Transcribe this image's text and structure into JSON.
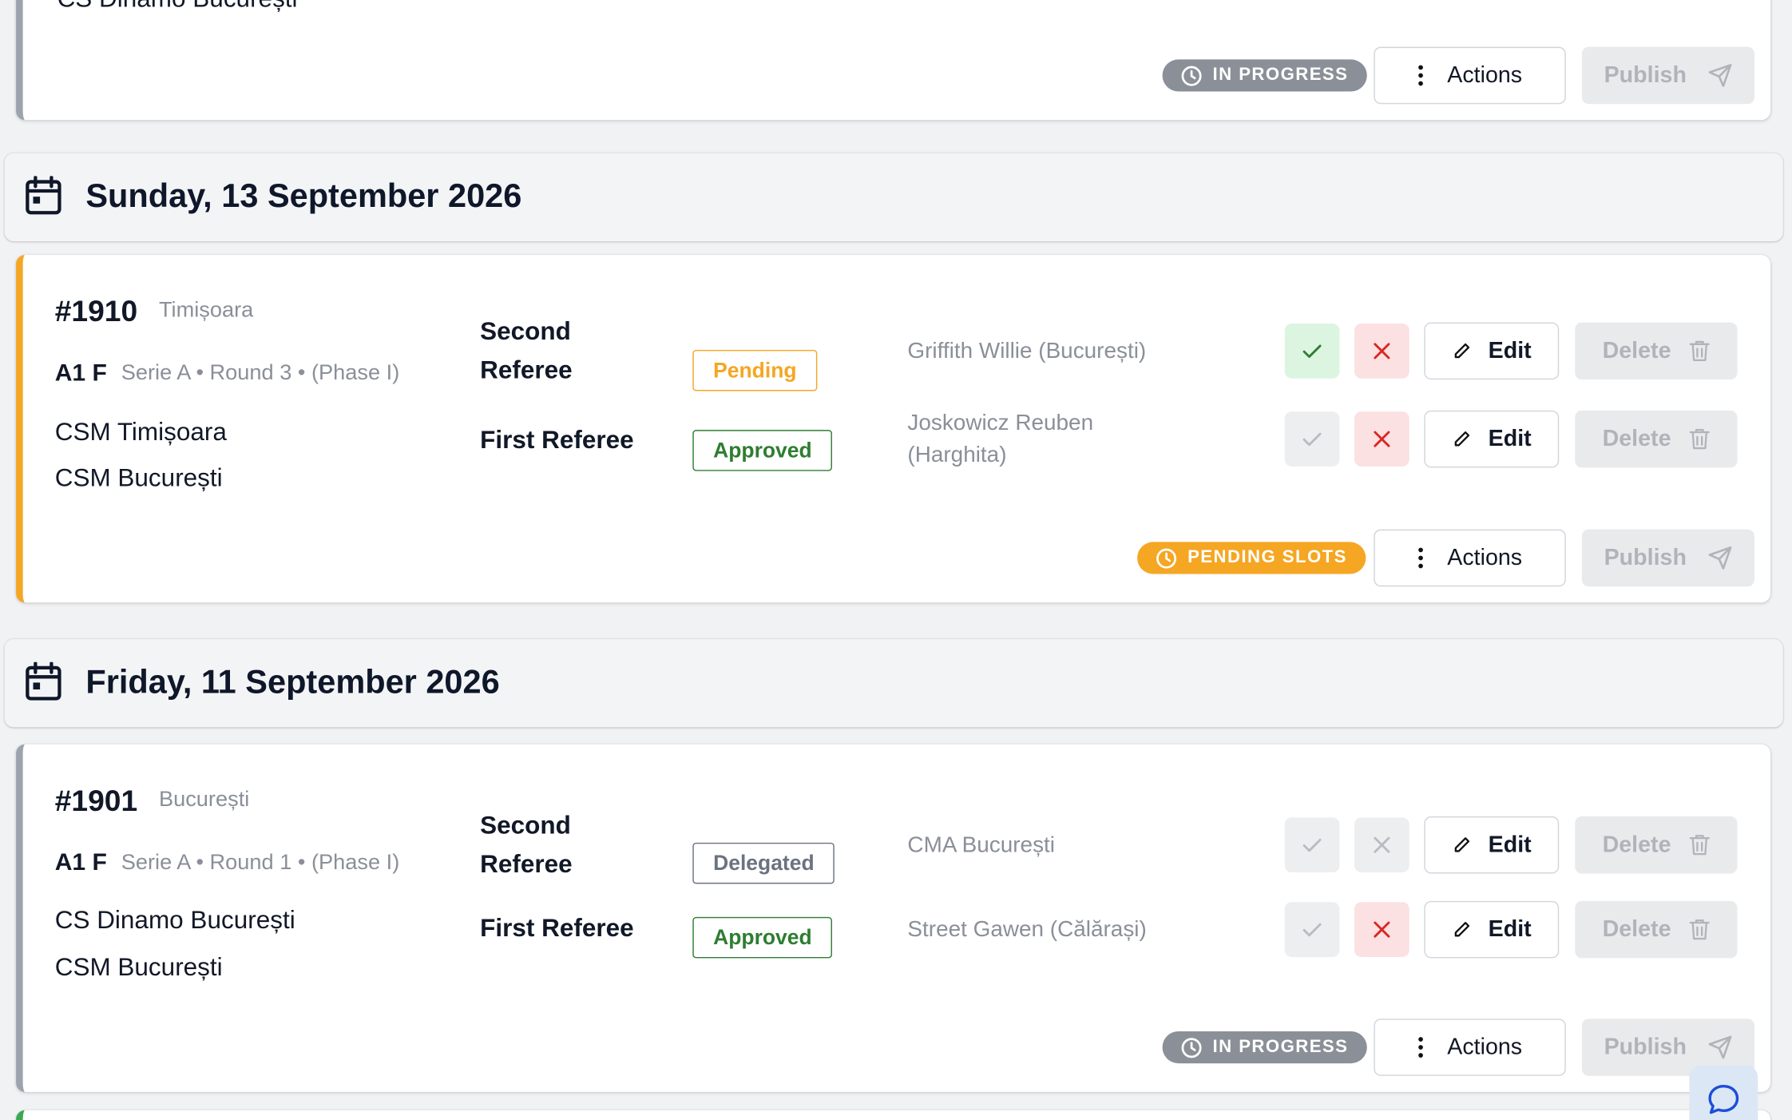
{
  "top_card": {
    "partial_team": "CS Dinamo București",
    "status": "IN PROGRESS",
    "actions_label": "Actions",
    "publish_label": "Publish"
  },
  "day1": {
    "title": "Sunday, 13 September 2026"
  },
  "match1910": {
    "number": "#1910",
    "city": "Timișoara",
    "category": "A1 F",
    "series": "Serie A • Round 3 • (Phase I)",
    "home": "CSM Timișoara",
    "away": "CSM București",
    "slots": [
      {
        "role_line1": "Second",
        "role_line2": "Referee",
        "status": "Pending",
        "person": "Griffith Willie (București)"
      },
      {
        "role": "First Referee",
        "status": "Approved",
        "person_line1": "Joskowicz Reuben",
        "person_line2": "(Harghita)"
      }
    ],
    "status_badge": "PENDING SLOTS",
    "actions_label": "Actions",
    "publish_label": "Publish"
  },
  "day2": {
    "title": "Friday, 11 September 2026"
  },
  "match1901": {
    "number": "#1901",
    "city": "București",
    "category": "A1 F",
    "series": "Serie A • Round 1 • (Phase I)",
    "home": "CS Dinamo București",
    "away": "CSM București",
    "slots": [
      {
        "role_line1": "Second",
        "role_line2": "Referee",
        "status": "Delegated",
        "person": "CMA București"
      },
      {
        "role": "First Referee",
        "status": "Approved",
        "person": "Street Gawen (Călărași)"
      }
    ],
    "status_badge": "IN PROGRESS",
    "actions_label": "Actions",
    "publish_label": "Publish"
  },
  "labels": {
    "edit": "Edit",
    "delete": "Delete"
  },
  "colors": {
    "pending": "#f5a623",
    "approved": "#2e7d32",
    "delegated": "#6b7280",
    "in_progress": "#8b9098",
    "card_accent_grey": "#9ca3af",
    "card_accent_orange": "#f5a623",
    "card_accent_green": "#3aa852"
  }
}
